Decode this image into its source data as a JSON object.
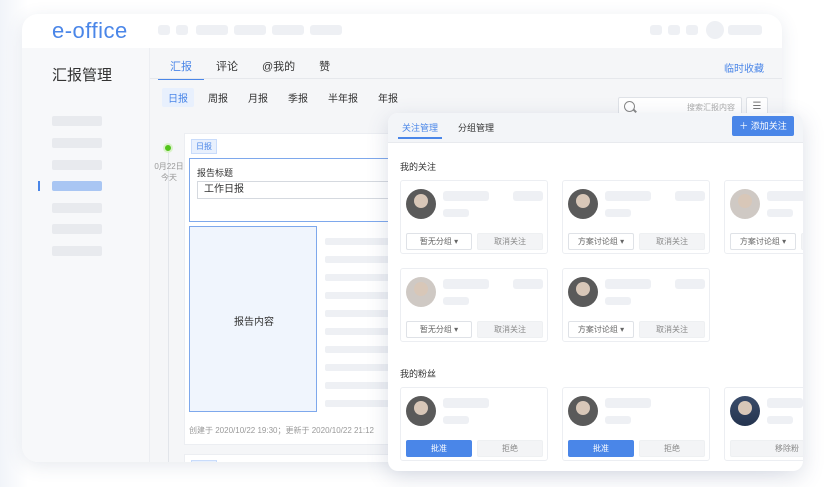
{
  "app": {
    "logo": "e-office"
  },
  "sidebar": {
    "title": "汇报管理"
  },
  "tabs": [
    "汇报",
    "评论",
    "@我的",
    "赞"
  ],
  "quick_fav": "临时收藏",
  "period_tabs": [
    "日报",
    "周报",
    "月报",
    "季报",
    "半年报",
    "年报"
  ],
  "search": {
    "placeholder": "搜索汇报内容"
  },
  "timeline": {
    "date": "0月22日",
    "today": "今天"
  },
  "report": {
    "badge": "日报",
    "title_label": "报告标题",
    "title_value": "工作日报",
    "content_label": "报告内容",
    "footer": "创建于 2020/10/22 19:30；更新于 2020/10/22 21:12"
  },
  "report2": {
    "badge": "日报"
  },
  "panel": {
    "tab_follow": "关注管理",
    "tab_group": "分组管理",
    "add_label": "添加关注",
    "my_follow": "我的关注",
    "my_fans": "我的粉丝",
    "follow_cards": [
      {
        "group": "暂无分组",
        "unfollow": "取消关注"
      },
      {
        "group": "方案讨论组",
        "unfollow": "取消关注"
      },
      {
        "group": "方案讨论组",
        "unfollow": "取"
      },
      {
        "group": "暂无分组",
        "unfollow": "取消关注"
      },
      {
        "group": "方案讨论组",
        "unfollow": "取消关注"
      }
    ],
    "fan_cards": [
      {
        "approve": "批准",
        "reject": "拒绝"
      },
      {
        "approve": "批准",
        "reject": "拒绝"
      },
      {
        "remove": "移除粉"
      }
    ]
  }
}
